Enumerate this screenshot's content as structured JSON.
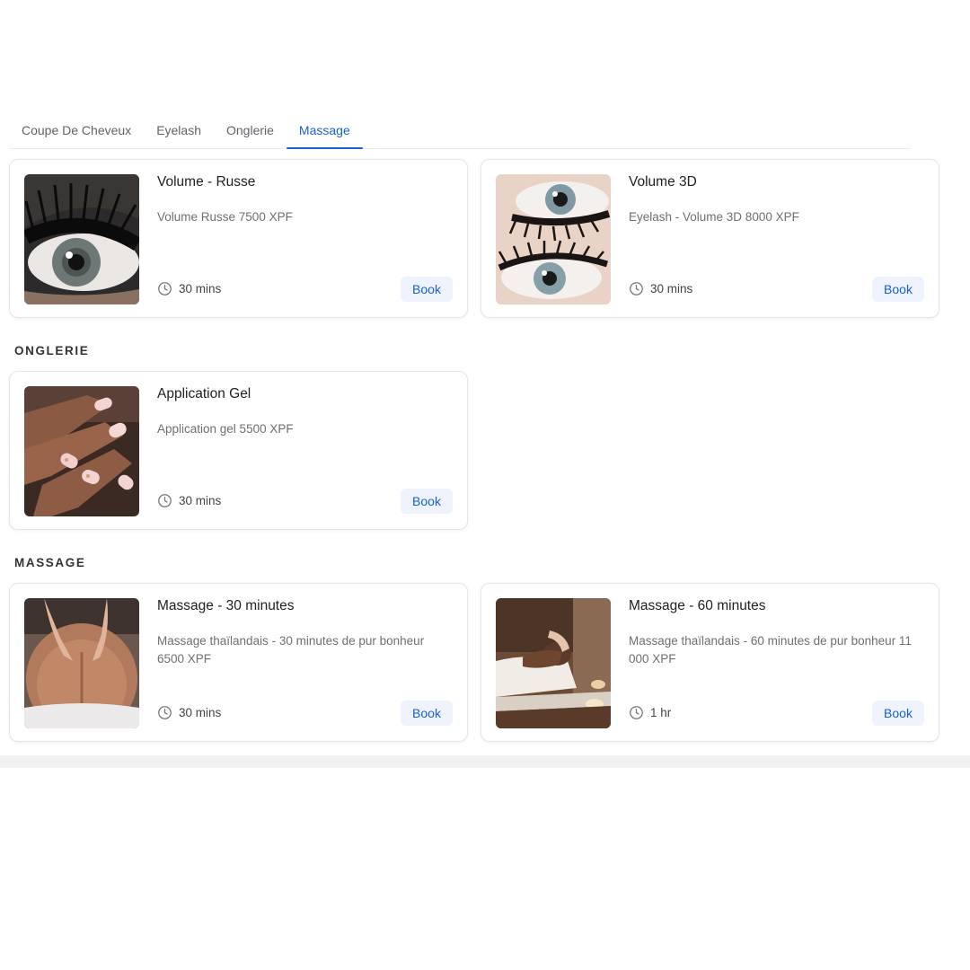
{
  "tabs": [
    {
      "label": "Coupe De Cheveux",
      "active": false
    },
    {
      "label": "Eyelash",
      "active": false
    },
    {
      "label": "Onglerie",
      "active": false
    },
    {
      "label": "Massage",
      "active": true
    }
  ],
  "eyelash_cards": [
    {
      "title": "Volume - Russe",
      "description": "Volume Russe 7500 XPF",
      "duration": "30 mins",
      "book_label": "Book"
    },
    {
      "title": "Volume 3D",
      "description": "Eyelash - Volume 3D 8000 XPF",
      "duration": "30 mins",
      "book_label": "Book"
    }
  ],
  "onglerie": {
    "heading": "ONGLERIE",
    "cards": [
      {
        "title": "Application Gel",
        "description": "Application gel 5500 XPF",
        "duration": "30 mins",
        "book_label": "Book"
      }
    ]
  },
  "massage": {
    "heading": "MASSAGE",
    "cards": [
      {
        "title": "Massage - 30 minutes",
        "description": "Massage thaïlandais - 30 minutes de pur bonheur 6500 XPF",
        "duration": "30 mins",
        "book_label": "Book"
      },
      {
        "title": "Massage - 60 minutes",
        "description": "Massage thaïlandais - 60 minutes de pur bonheur 11 000 XPF",
        "duration": "1 hr",
        "book_label": "Book"
      }
    ]
  },
  "icons": {
    "duration": "clock-icon"
  },
  "colors": {
    "accent": "#1a5fd1",
    "button_bg": "#eef3fd"
  }
}
